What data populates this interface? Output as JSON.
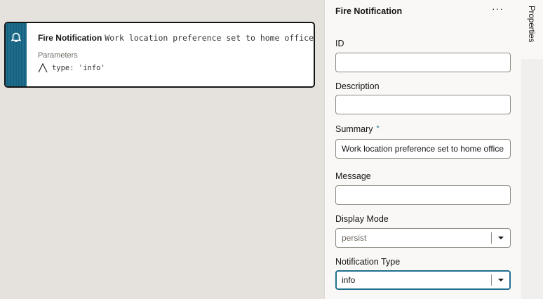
{
  "card": {
    "title": "Fire Notification",
    "summary": "Work location preference set to home office",
    "params_label": "Parameters",
    "param": "type: 'info'"
  },
  "panel": {
    "title": "Fire Notification",
    "more": "···",
    "fields": {
      "id": {
        "label": "ID",
        "value": ""
      },
      "description": {
        "label": "Description",
        "value": ""
      },
      "summary": {
        "label": "Summary",
        "required": "*",
        "value": "Work location preference set to home office"
      },
      "message": {
        "label": "Message",
        "value": ""
      },
      "display_mode": {
        "label": "Display Mode",
        "value": "persist"
      },
      "notification_type": {
        "label": "Notification Type",
        "value": "info"
      }
    }
  },
  "side": {
    "tab": "Properties"
  }
}
